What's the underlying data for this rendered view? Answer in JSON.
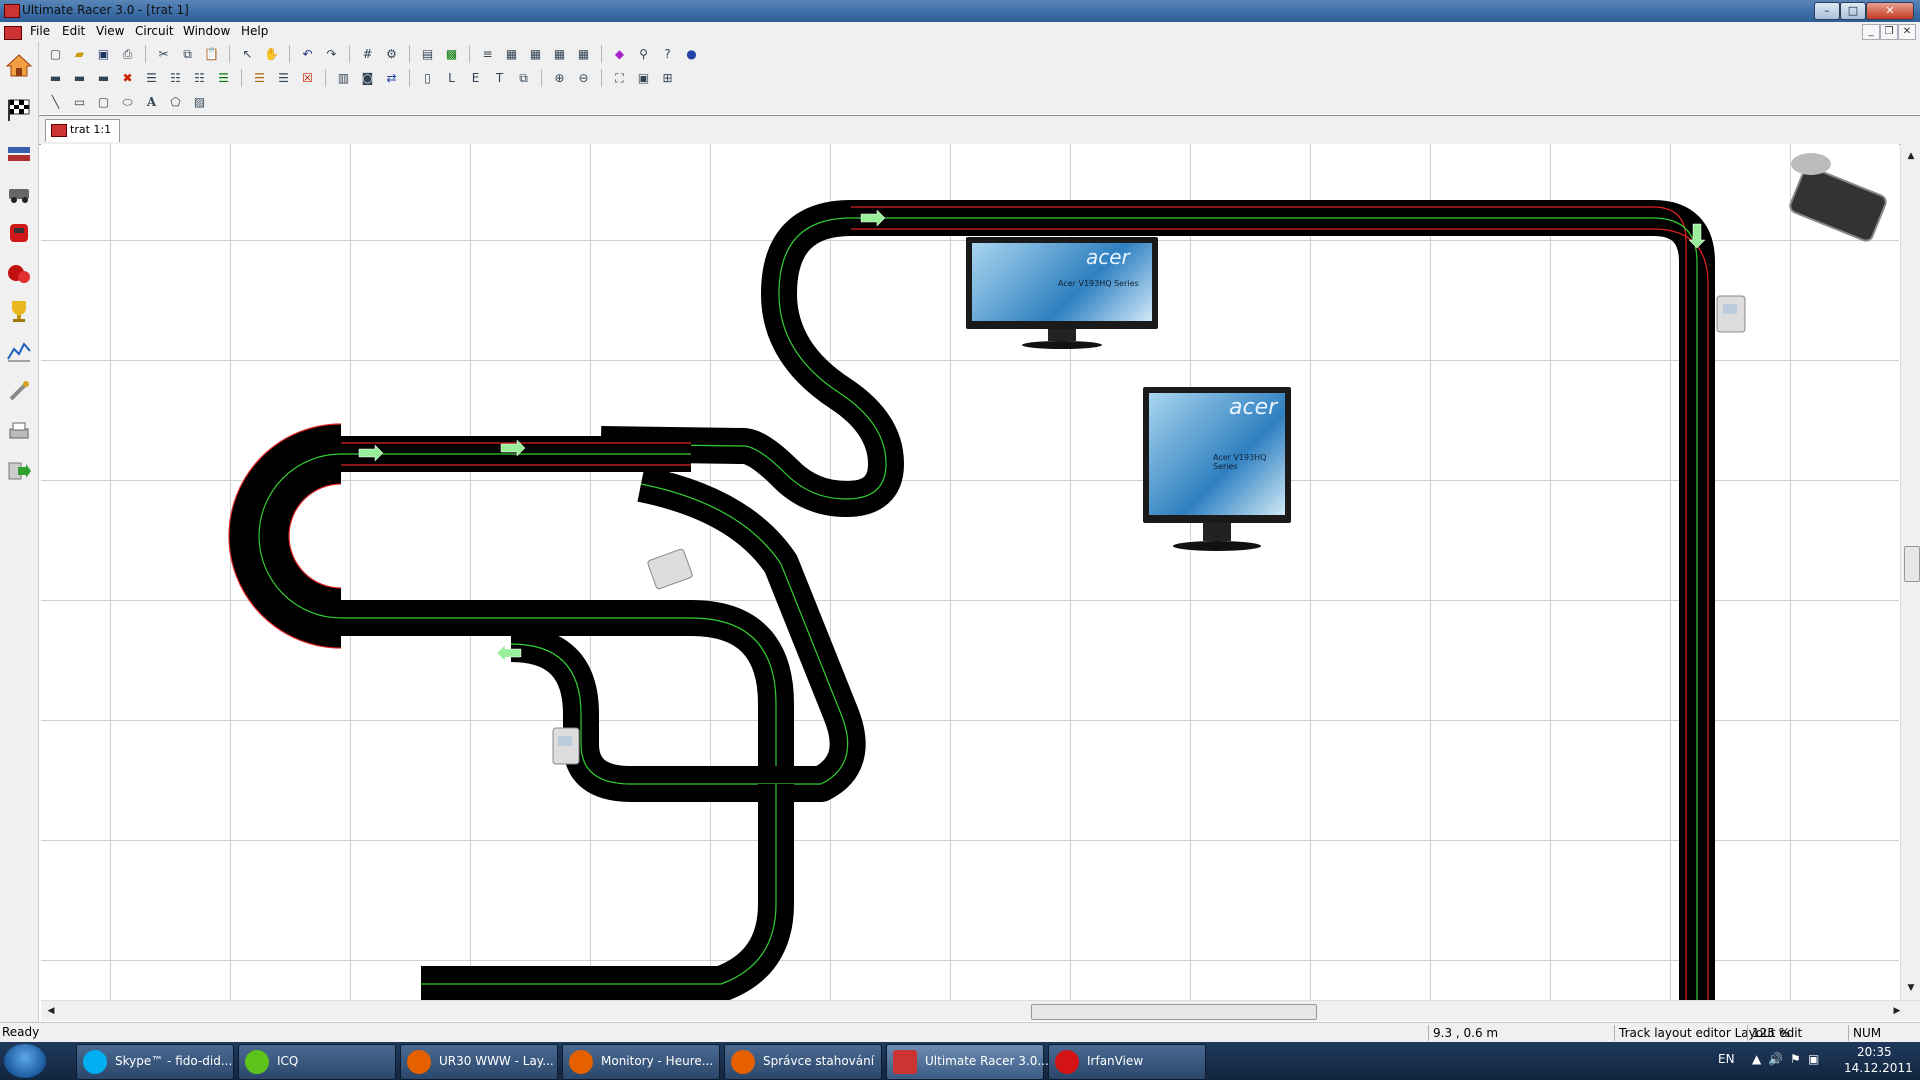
{
  "window": {
    "title": "Ultimate Racer 3.0 - [trat 1]",
    "min_glyph": "–",
    "max_glyph": "□",
    "close_glyph": "✕"
  },
  "menu": {
    "items": [
      "File",
      "Edit",
      "View",
      "Circuit",
      "Window",
      "Help"
    ]
  },
  "mdi_buttons": {
    "min": "_",
    "restore": "❐",
    "close": "✕"
  },
  "sidebar_icons": [
    "home-icon",
    "checkered-flag-icon",
    "drivers-icon",
    "car-icon",
    "car-red-icon",
    "race-car-icon",
    "trophy-icon",
    "chart-icon",
    "tools-icon",
    "printer-icon",
    "exit-icon"
  ],
  "document_tab": {
    "label": "trat 1:1"
  },
  "canvas": {
    "monitors": [
      {
        "brand": "acer",
        "model": "Acer V193HQ Series"
      },
      {
        "brand": "acer",
        "model": "Acer V193HQ Series"
      }
    ]
  },
  "statusbar": {
    "ready": "Ready",
    "coords": "9.3 , 0.6 m",
    "mode": "Track layout editor Layout edit",
    "zoom": "125 %",
    "num": "NUM"
  },
  "taskbar": {
    "tasks": [
      {
        "label": "Skype™ - fido-did...",
        "icon": "skype-icon",
        "color": "#00aff0"
      },
      {
        "label": "ICQ",
        "icon": "icq-flower-icon",
        "color": "#5cc31b"
      },
      {
        "label": "UR30 WWW - Lay...",
        "icon": "firefox-icon",
        "color": "#e66000"
      },
      {
        "label": "Monitory - Heure...",
        "icon": "firefox-icon",
        "color": "#e66000"
      },
      {
        "label": "Správce stahování",
        "icon": "firefox-icon",
        "color": "#e66000"
      },
      {
        "label": "Ultimate Racer 3.0...",
        "icon": "ultimate-racer-icon",
        "color": "#cc3333"
      },
      {
        "label": "IrfanView",
        "icon": "irfanview-icon",
        "color": "#d41414"
      }
    ],
    "tray": {
      "lang": "EN",
      "time": "20:35",
      "date": "14.12.2011"
    }
  }
}
